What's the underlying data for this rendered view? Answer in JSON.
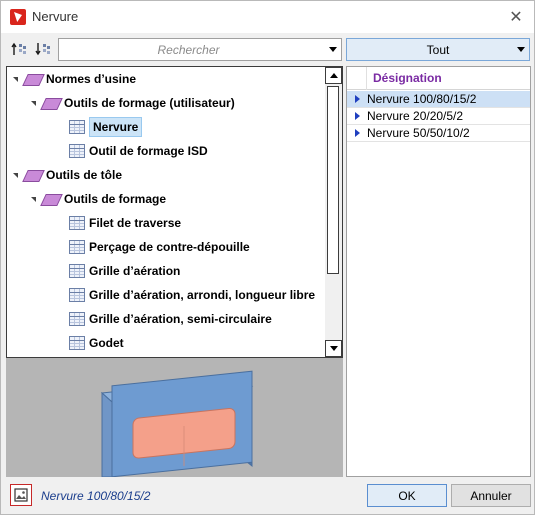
{
  "window": {
    "title": "Nervure",
    "close_glyph": "✕"
  },
  "toolbar": {
    "search_placeholder": "Rechercher",
    "filter_value": "Tout"
  },
  "tree": {
    "items": [
      {
        "label": "Normes d’usine",
        "level": 0,
        "icon": "book-icon"
      },
      {
        "label": "Outils de formage (utilisateur)",
        "level": 1,
        "icon": "book-icon"
      },
      {
        "label": "Nervure",
        "level": 2,
        "icon": "grid-icon",
        "selected": true
      },
      {
        "label": "Outil de formage ISD",
        "level": 2,
        "icon": "grid-icon"
      },
      {
        "label": "Outils de tôle",
        "level": 0,
        "icon": "book-icon"
      },
      {
        "label": "Outils de formage",
        "level": 1,
        "icon": "book-icon"
      },
      {
        "label": "Filet de traverse",
        "level": 2,
        "icon": "grid-icon"
      },
      {
        "label": "Perçage de contre-dépouille",
        "level": 2,
        "icon": "grid-icon"
      },
      {
        "label": "Grille d’aération",
        "level": 2,
        "icon": "grid-icon"
      },
      {
        "label": "Grille d’aération, arrondi, longueur libre",
        "level": 2,
        "icon": "grid-icon"
      },
      {
        "label": "Grille d’aération, semi-circulaire",
        "level": 2,
        "icon": "grid-icon"
      },
      {
        "label": "Godet",
        "level": 2,
        "icon": "grid-icon"
      }
    ]
  },
  "list": {
    "header": "Désignation",
    "rows": [
      {
        "label": "Nervure 100/80/15/2",
        "selected": true
      },
      {
        "label": "Nervure 20/20/5/2",
        "selected": false
      },
      {
        "label": "Nervure 50/50/10/2",
        "selected": false
      }
    ]
  },
  "footer": {
    "status": "Nervure 100/80/15/2",
    "ok_label": "OK",
    "cancel_label": "Annuler"
  },
  "colors": {
    "accent": "#0078d7",
    "header_text": "#7a2aa3",
    "status_text": "#1a3d8c",
    "preview_plate": "#6e9bd1",
    "preview_face": "#f4a08a"
  }
}
